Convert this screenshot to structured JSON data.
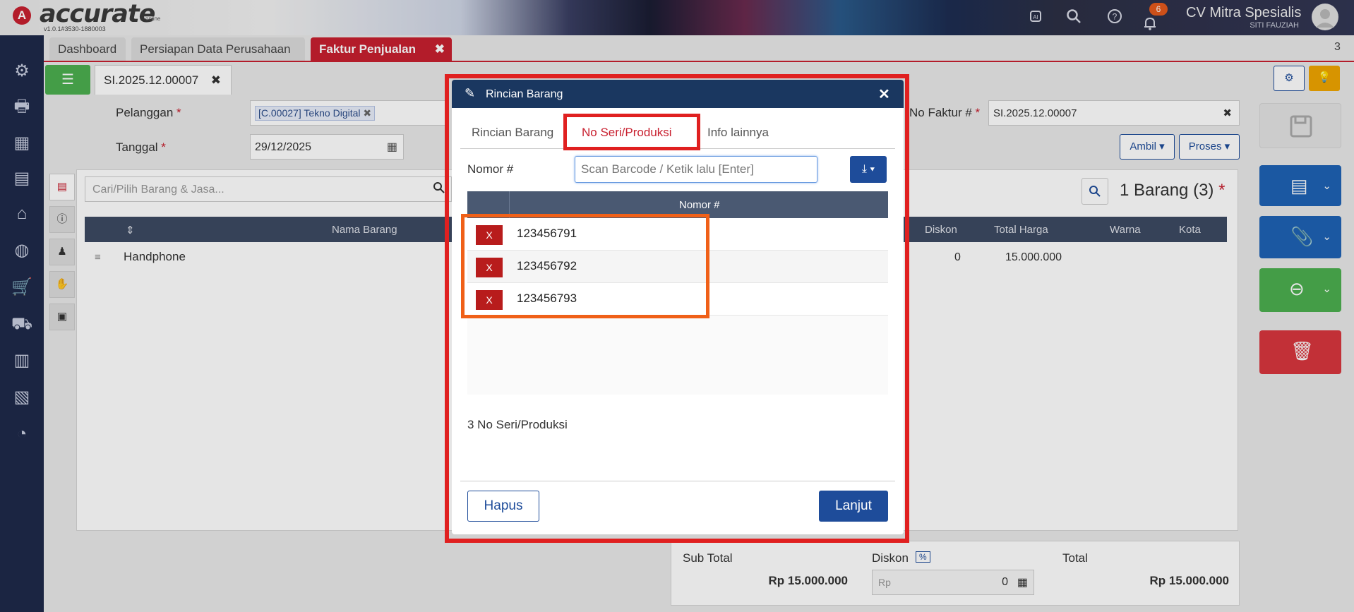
{
  "app": {
    "logo_mark": "A",
    "logo_text": "accurate",
    "logo_sub": "online",
    "version": "v1.0.1#3530-1880003",
    "notifications": "6",
    "company": "CV Mitra Spesialis",
    "user": "SITI FAUZIAH",
    "tab_count": "3"
  },
  "tabs": [
    {
      "label": "Dashboard"
    },
    {
      "label": "Persiapan Data Perusahaan"
    },
    {
      "label": "Faktur Penjualan",
      "close": "✖"
    }
  ],
  "doc": {
    "number": "SI.2025.12.00007",
    "close": "✖",
    "pelanggan_label": "Pelanggan",
    "pelanggan_value": "[C.00027] Tekno Digital",
    "tanggal_label": "Tanggal",
    "tanggal_value": "29/12/2025",
    "nofaktur_label": "No Faktur #",
    "nofaktur_value": "SI.2025.12.00007",
    "ambil_label": "Ambil",
    "proses_label": "Proses",
    "required_mark": "*",
    "search_placeholder": "Cari/Pilih Barang & Jasa...",
    "count_label": "1 Barang (3)",
    "columns": {
      "nama_barang": "Nama Barang",
      "diskon": "Diskon",
      "total_harga": "Total Harga",
      "warna": "Warna",
      "kota": "Kota"
    },
    "row": {
      "name": "Handphone",
      "diskon": "0",
      "total": "15.000.000"
    }
  },
  "summary": {
    "subtotal_label": "Sub Total",
    "subtotal_value": "Rp 15.000.000",
    "diskon_label": "Diskon",
    "diskon_unit": "%",
    "diskon_prefix": "Rp",
    "diskon_value": "0",
    "total_label": "Total",
    "total_value": "Rp 15.000.000"
  },
  "modal": {
    "title": "Rincian Barang",
    "close": "✕",
    "tabs": [
      {
        "label": "Rincian Barang"
      },
      {
        "label": "No Seri/Produksi"
      },
      {
        "label": "Info lainnya"
      }
    ],
    "nomor_label": "Nomor #",
    "nomor_placeholder": "Scan Barcode / Ketik lalu [Enter]",
    "column_header": "Nomor #",
    "rows": [
      {
        "remove": "X",
        "value": "123456791"
      },
      {
        "remove": "X",
        "value": "123456792"
      },
      {
        "remove": "X",
        "value": "123456793"
      }
    ],
    "count_text": "3 No Seri/Produksi",
    "hapus_label": "Hapus",
    "lanjut_label": "Lanjut"
  },
  "colors": {
    "brand_red": "#c8202f",
    "navy": "#1a3760",
    "highlight_red": "#e02020",
    "highlight_orange": "#f06018",
    "primary_blue": "#1e4c9a"
  }
}
